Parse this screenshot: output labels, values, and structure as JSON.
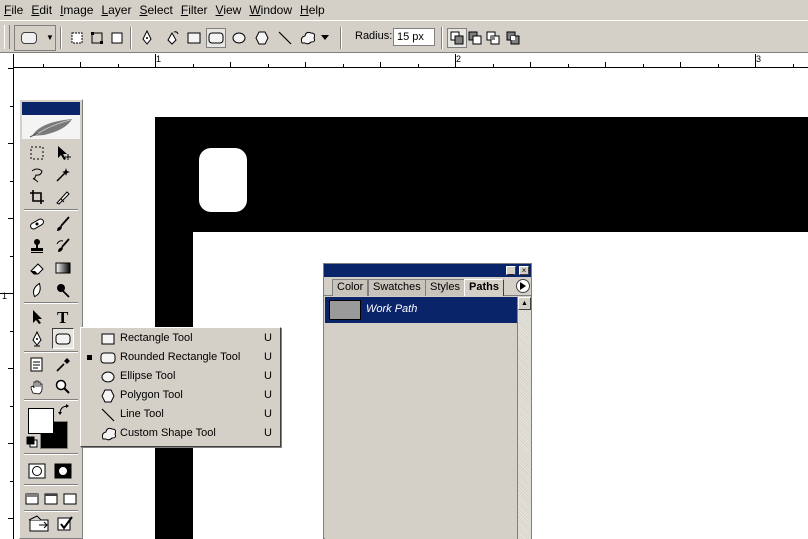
{
  "menu": [
    "File",
    "Edit",
    "Image",
    "Layer",
    "Select",
    "Filter",
    "View",
    "Window",
    "Help"
  ],
  "options_bar": {
    "radius_label": "Radius:",
    "radius_value": "15 px"
  },
  "rulers": {
    "h_labels": [
      "1",
      "2",
      "3"
    ],
    "v_labels": [
      "1"
    ]
  },
  "toolbox": {
    "active_tool": "rounded-rectangle-tool",
    "foreground_color": "#ffffff",
    "background_color": "#000000"
  },
  "flyout": {
    "items": [
      {
        "label": "Rectangle Tool",
        "shortcut": "U",
        "icon": "rectangle-icon",
        "checked": false
      },
      {
        "label": "Rounded Rectangle Tool",
        "shortcut": "U",
        "icon": "rounded-rectangle-icon",
        "checked": true
      },
      {
        "label": "Ellipse Tool",
        "shortcut": "U",
        "icon": "ellipse-icon",
        "checked": false
      },
      {
        "label": "Polygon Tool",
        "shortcut": "U",
        "icon": "polygon-icon",
        "checked": false
      },
      {
        "label": "Line Tool",
        "shortcut": "U",
        "icon": "line-icon",
        "checked": false
      },
      {
        "label": "Custom Shape Tool",
        "shortcut": "U",
        "icon": "custom-shape-icon",
        "checked": false
      }
    ]
  },
  "paths_palette": {
    "tabs": [
      "Color",
      "Swatches",
      "Styles",
      "Paths"
    ],
    "active_tab": "Paths",
    "paths": [
      {
        "name": "Work Path",
        "selected": true
      }
    ]
  },
  "colors": {
    "chrome": "#d4d0c8",
    "title_blue": "#0a246a",
    "selection": "#0a246a"
  }
}
